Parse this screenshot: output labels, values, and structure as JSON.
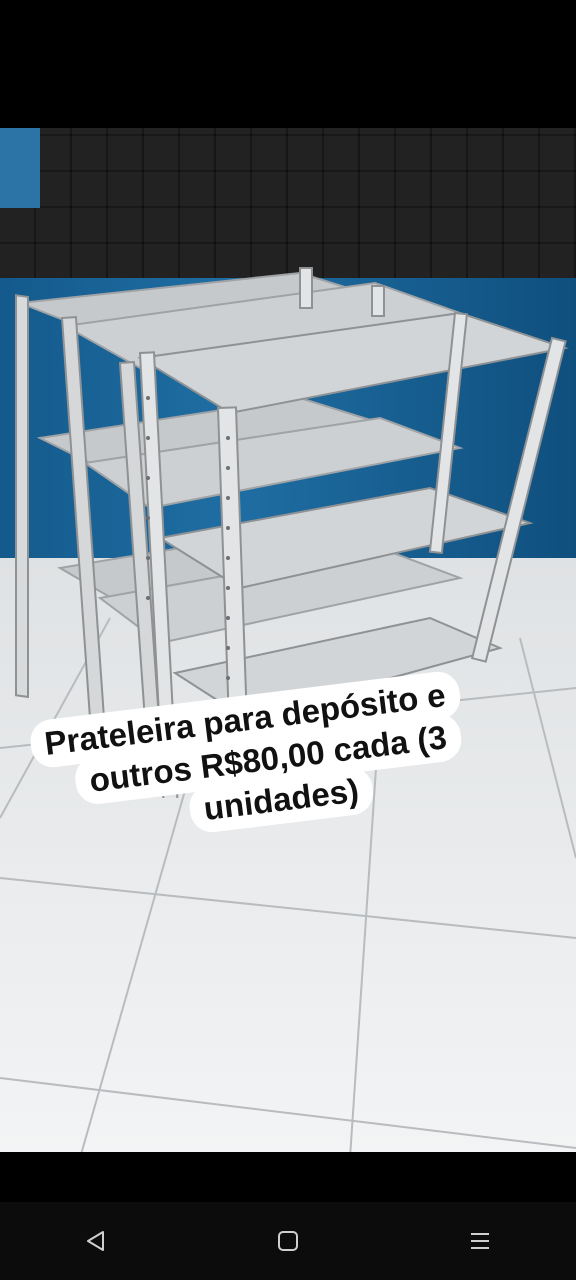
{
  "caption": {
    "line1": "Prateleira para depósito e",
    "line2": "outros R$80,00 cada (3",
    "line3": "unidades)"
  },
  "navbar": {
    "back_icon": "back-triangle-icon",
    "home_icon": "home-square-icon",
    "recents_icon": "recents-menu-icon"
  },
  "colors": {
    "wall_blue": "#1b5a80",
    "shelf_gray": "#c9ccce",
    "floor": "#e7e9ea",
    "navbar": "#0c0c0c"
  }
}
